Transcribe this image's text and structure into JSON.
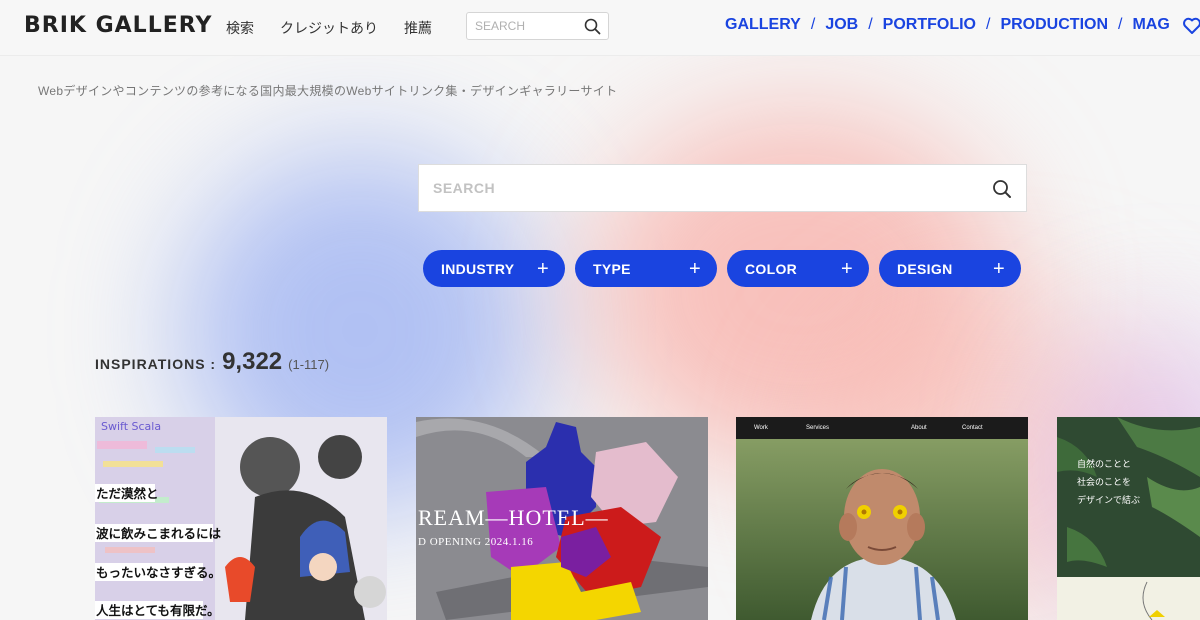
{
  "header": {
    "logo": "BRIK GALLERY",
    "jp_nav": [
      "検索",
      "クレジットあり",
      "推薦"
    ],
    "search_placeholder": "SEARCH",
    "en_nav": [
      "GALLERY",
      "JOB",
      "PORTFOLIO",
      "PRODUCTION",
      "MAG"
    ],
    "separator": "/"
  },
  "tagline": "Webデザインやコンテンツの参考になる国内最大規模のWebサイトリンク集・デザインギャラリーサイト",
  "main_search": {
    "placeholder": "SEARCH"
  },
  "filters": [
    {
      "label": "INDUSTRY",
      "icon": "+"
    },
    {
      "label": "TYPE",
      "icon": "+"
    },
    {
      "label": "COLOR",
      "icon": "+"
    },
    {
      "label": "DESIGN",
      "icon": "+"
    }
  ],
  "inspirations": {
    "label": "INSPIRATIONS :",
    "count": "9,322",
    "range": "(1-117)"
  },
  "cards": [
    {
      "lines": [
        "ただ漠然と",
        "波に飲みこまれるには",
        "もったいなさすぎる。",
        "人生はとても有限だ。"
      ],
      "top_text": "Swift Scala"
    },
    {
      "title": "REAM—HOTEL—",
      "subtitle": "D OPENING 2024.1.16"
    },
    {
      "nav": [
        "Work",
        "Services",
        "About",
        "Contact"
      ]
    },
    {
      "lines": [
        "自然のことと",
        "社会のことを",
        "デザインで結ぶ"
      ]
    }
  ],
  "colors": {
    "accent": "#1a44e0",
    "background": "#f6f6f6"
  },
  "icons": {
    "search": "search-icon",
    "heart": "heart-icon",
    "plus": "plus-icon"
  }
}
